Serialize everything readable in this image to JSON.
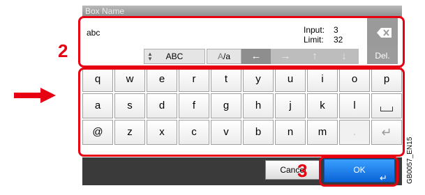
{
  "dialog": {
    "title": "Box Name"
  },
  "input": {
    "value": "abc",
    "count_label": "Input:",
    "count_value": "3",
    "limit_label": "Limit:",
    "limit_value": "32"
  },
  "controls": {
    "abc_label": "ABC",
    "case_label_a": "A",
    "case_label_b": "/a",
    "left_arrow": "←",
    "right_arrow": "→",
    "up_arrow": "↑",
    "down_arrow": "↓",
    "del_label": "Del."
  },
  "keyboard": {
    "row1": [
      "q",
      "w",
      "e",
      "r",
      "t",
      "y",
      "u",
      "i",
      "o",
      "p"
    ],
    "row2": [
      "a",
      "s",
      "d",
      "f",
      "g",
      "h",
      "j",
      "k",
      "l"
    ],
    "row3": [
      "@",
      "z",
      "x",
      "c",
      "v",
      "b",
      "n",
      "m",
      "."
    ]
  },
  "footer": {
    "cancel_label": "Cancel",
    "ok_label": "OK"
  },
  "callouts": {
    "step2": "2",
    "step3": "3"
  },
  "figure_code": "GB0057_EN15",
  "colors": {
    "highlight": "#e60012",
    "ok_button": "#1f7fe8",
    "bottom_bar": "#3a3a3a"
  }
}
